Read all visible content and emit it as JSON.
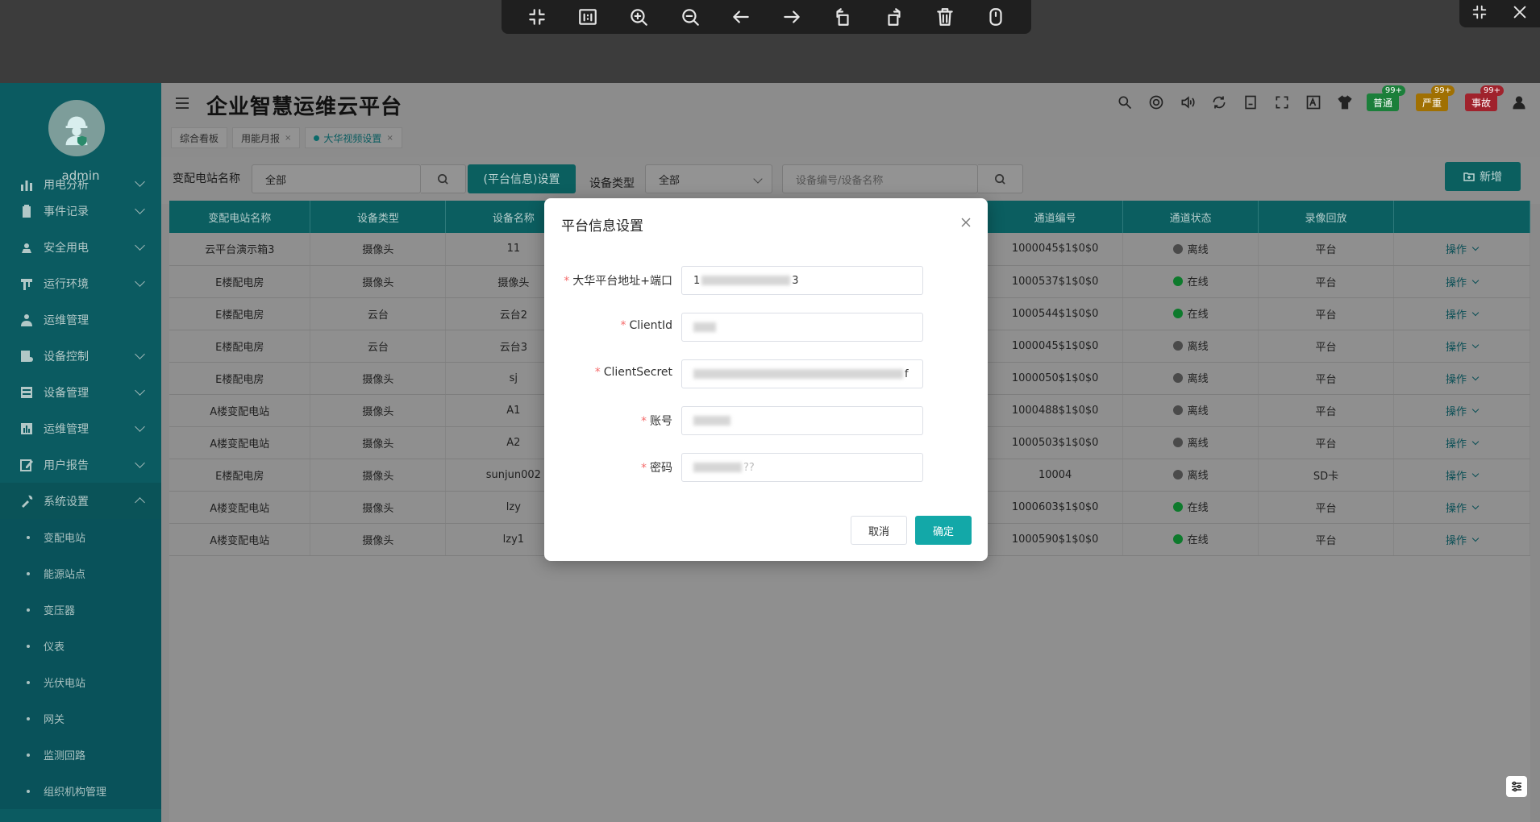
{
  "viewer": {
    "toolbar_icons": [
      "collapse-icon",
      "actual-size-icon",
      "zoom-in-icon",
      "zoom-out-icon",
      "prev-arrow-icon",
      "next-arrow-icon",
      "rotate-left-icon",
      "rotate-right-icon",
      "delete-icon",
      "lock-icon"
    ]
  },
  "sidebar": {
    "username": "admin",
    "items": [
      {
        "label": "用电分析",
        "icon": "bar-chart-icon",
        "expandable": true
      },
      {
        "label": "事件记录",
        "icon": "clipboard-icon",
        "expandable": true
      },
      {
        "label": "安全用电",
        "icon": "safety-icon",
        "expandable": true
      },
      {
        "label": "运行环境",
        "icon": "environment-icon",
        "expandable": true
      },
      {
        "label": "运维管理",
        "icon": "worker-icon",
        "expandable": false
      },
      {
        "label": "设备控制",
        "icon": "control-icon",
        "expandable": true
      },
      {
        "label": "设备管理",
        "icon": "device-icon",
        "expandable": true
      },
      {
        "label": "运维管理",
        "icon": "dashboard-icon",
        "expandable": true
      },
      {
        "label": "用户报告",
        "icon": "edit-icon",
        "expandable": true
      },
      {
        "label": "系统设置",
        "icon": "tools-icon",
        "expandable": true,
        "expanded": true
      }
    ],
    "sub_items": [
      "变配电站",
      "能源站点",
      "变压器",
      "仪表",
      "光伏电站",
      "网关",
      "监测回路",
      "组织机构管理"
    ]
  },
  "header": {
    "title": "企业智慧运维云平台",
    "tags": [
      {
        "label": "综合看板",
        "closable": false,
        "active": false
      },
      {
        "label": "用能月报",
        "closable": true,
        "active": false
      },
      {
        "label": "大华视频设置",
        "closable": true,
        "active": true
      }
    ],
    "close_glyph": "×",
    "badges": [
      {
        "label": "普通",
        "count": "99+"
      },
      {
        "label": "严重",
        "count": "99+"
      },
      {
        "label": "事故",
        "count": "99+"
      }
    ]
  },
  "filter": {
    "station_label": "变配电站名称",
    "station_value": "全部",
    "platform_button": "(平台信息)设置",
    "device_type_label": "设备类型",
    "device_type_value": "全部",
    "search_placeholder": "设备编号/设备名称",
    "add_button": "新增"
  },
  "table": {
    "columns": [
      "变配电站名称",
      "设备类型",
      "设备名称",
      "",
      "",
      "",
      "通道编号",
      "通道状态",
      "录像回放",
      ""
    ],
    "rows": [
      {
        "station": "云平台演示箱3",
        "type": "摄像头",
        "name": "11",
        "channel": "1000045$1$0$0",
        "status": "离线",
        "online": false,
        "playback": "平台",
        "op": "操作"
      },
      {
        "station": "E楼配电房",
        "type": "摄像头",
        "name": "摄像头",
        "channel": "1000537$1$0$0",
        "status": "在线",
        "online": true,
        "playback": "平台",
        "op": "操作"
      },
      {
        "station": "E楼配电房",
        "type": "云台",
        "name": "云台2",
        "channel": "1000544$1$0$0",
        "status": "在线",
        "online": true,
        "playback": "平台",
        "op": "操作"
      },
      {
        "station": "E楼配电房",
        "type": "云台",
        "name": "云台3",
        "channel": "1000045$1$0$0",
        "status": "离线",
        "online": false,
        "playback": "平台",
        "op": "操作"
      },
      {
        "station": "E楼配电房",
        "type": "摄像头",
        "name": "sj",
        "channel": "1000050$1$0$0",
        "status": "离线",
        "online": false,
        "playback": "平台",
        "op": "操作"
      },
      {
        "station": "A楼变配电站",
        "type": "摄像头",
        "name": "A1",
        "channel": "1000488$1$0$0",
        "status": "离线",
        "online": false,
        "playback": "平台",
        "op": "操作"
      },
      {
        "station": "A楼变配电站",
        "type": "摄像头",
        "name": "A2",
        "channel": "1000503$1$0$0",
        "status": "离线",
        "online": false,
        "playback": "平台",
        "op": "操作"
      },
      {
        "station": "E楼配电房",
        "type": "摄像头",
        "name": "sunjun002",
        "channel": "10004",
        "status": "离线",
        "online": false,
        "playback": "SD卡",
        "op": "操作"
      },
      {
        "station": "A楼变配电站",
        "type": "摄像头",
        "name": "lzy",
        "channel": "1000603$1$0$0",
        "status": "在线",
        "online": true,
        "playback": "平台",
        "op": "操作"
      },
      {
        "station": "A楼变配电站",
        "type": "摄像头",
        "name": "lzy1",
        "channel": "1000590$1$0$0",
        "status": "在线",
        "online": true,
        "playback": "平台",
        "op": "操作"
      }
    ]
  },
  "modal": {
    "title": "平台信息设置",
    "required_mark": "*",
    "fields": [
      {
        "label": "大华平台地址+端口",
        "value_start": "1",
        "value_end": "3"
      },
      {
        "label": "ClientId",
        "value_start": "",
        "value_end": ""
      },
      {
        "label": "ClientSecret",
        "value_start": "",
        "value_end": "f"
      },
      {
        "label": "账号",
        "value_start": "",
        "value_end": ""
      },
      {
        "label": "密码",
        "value_start": "",
        "value_end": "??"
      }
    ],
    "cancel": "取消",
    "confirm": "确定"
  },
  "colors": {
    "primary": "#13a8a8",
    "sidebar": "#0b5b61",
    "online": "#0d7a2c",
    "offline": "#4a4a4a",
    "required": "#f56c6c"
  }
}
